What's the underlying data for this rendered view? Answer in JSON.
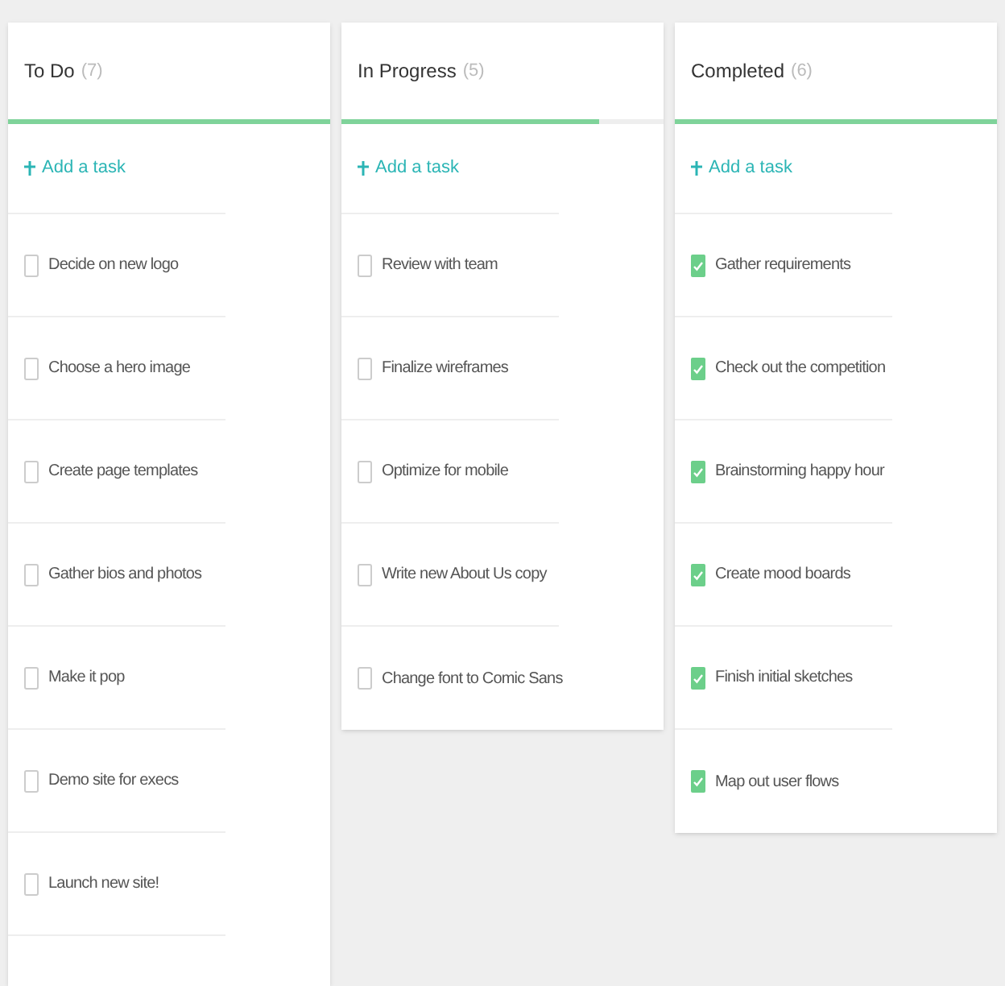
{
  "columns": [
    {
      "title": "To Do",
      "count": "(7)",
      "level": 1,
      "add_label": "Add a task",
      "tasks": [
        {
          "label": "Decide on new logo",
          "checked": false
        },
        {
          "label": "Choose a hero image",
          "checked": false
        },
        {
          "label": "Create page templates",
          "checked": false
        },
        {
          "label": "Gather bios and photos",
          "checked": false
        },
        {
          "label": "Make it pop",
          "checked": false
        },
        {
          "label": "Demo site for execs",
          "checked": false
        },
        {
          "label": "Launch new site!",
          "checked": false
        }
      ]
    },
    {
      "title": "In Progress",
      "count": "(5)",
      "level": 0.8,
      "add_label": "Add a task",
      "tasks": [
        {
          "label": "Review with team",
          "checked": false
        },
        {
          "label": "Finalize wireframes",
          "checked": false
        },
        {
          "label": "Optimize for mobile",
          "checked": false
        },
        {
          "label": "Write new About Us copy",
          "checked": false
        },
        {
          "label": "Change font to Comic Sans",
          "checked": false
        }
      ]
    },
    {
      "title": "Completed",
      "count": "(6)",
      "level": 1,
      "add_label": "Add a task",
      "tasks": [
        {
          "label": "Gather requirements",
          "checked": true
        },
        {
          "label": "Check out the competition",
          "checked": true
        },
        {
          "label": "Brainstorming happy hour",
          "checked": true
        },
        {
          "label": "Create mood boards",
          "checked": true
        },
        {
          "label": "Finish initial sketches",
          "checked": true
        },
        {
          "label": "Map out user flows",
          "checked": true
        }
      ]
    }
  ]
}
